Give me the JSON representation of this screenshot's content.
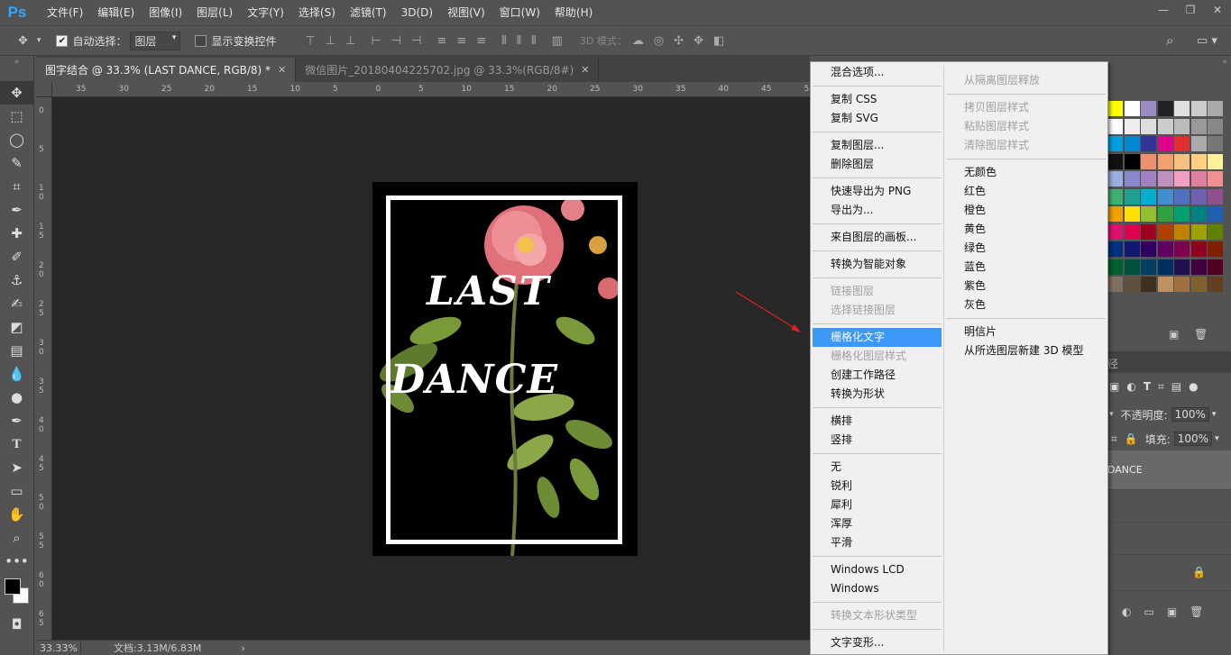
{
  "app": {
    "logo": "Ps"
  },
  "menu": [
    "文件(F)",
    "编辑(E)",
    "图像(I)",
    "图层(L)",
    "文字(Y)",
    "选择(S)",
    "滤镜(T)",
    "3D(D)",
    "视图(V)",
    "窗口(W)",
    "帮助(H)"
  ],
  "window_controls": {
    "minimize": "—",
    "restore": "❐",
    "close": "✕"
  },
  "options": {
    "auto_select_label": "自动选择：",
    "auto_select_value": "图层",
    "show_transform_label": "显示变换控件",
    "mode3d_label": "3D 模式："
  },
  "tabs": [
    {
      "title": "图字结合 @ 33.3% (LAST DANCE, RGB/8) *",
      "close": "✕"
    },
    {
      "title": "微信图片_20180404225702.jpg @ 33.3%(RGB/8#)",
      "close": "✕"
    }
  ],
  "ruler": {
    "top": [
      "35",
      "30",
      "25",
      "20",
      "15",
      "10",
      "5",
      "0",
      "5",
      "10",
      "15",
      "20",
      "25",
      "30",
      "35",
      "40",
      "45",
      "5"
    ],
    "left": [
      "0",
      "5",
      "1\n0",
      "1\n5",
      "2\n0",
      "2\n5",
      "3\n0",
      "3\n5",
      "4\n0",
      "4\n5",
      "5\n0",
      "5\n5",
      "6\n0",
      "6\n5"
    ]
  },
  "artwork": {
    "line1": "LAST",
    "line2": "DANCE"
  },
  "status": {
    "zoom": "33.33%",
    "doc": "文档:3.13M/6.83M",
    "arrow": "›"
  },
  "context_menu": {
    "col1": [
      {
        "t": "混合选项...",
        "s": "n"
      },
      {
        "sep": true
      },
      {
        "t": "复制 CSS",
        "s": "n"
      },
      {
        "t": "复制 SVG",
        "s": "n"
      },
      {
        "sep": true
      },
      {
        "t": "复制图层...",
        "s": "n"
      },
      {
        "t": "删除图层",
        "s": "n"
      },
      {
        "sep": true
      },
      {
        "t": "快速导出为 PNG",
        "s": "n"
      },
      {
        "t": "导出为...",
        "s": "n"
      },
      {
        "sep": true
      },
      {
        "t": "来自图层的画板...",
        "s": "n"
      },
      {
        "sep": true
      },
      {
        "t": "转换为智能对象",
        "s": "n"
      },
      {
        "sep": true
      },
      {
        "t": "链接图层",
        "s": "d"
      },
      {
        "t": "选择链接图层",
        "s": "d"
      },
      {
        "sep": true
      },
      {
        "t": "栅格化文字",
        "s": "h"
      },
      {
        "t": "栅格化图层样式",
        "s": "d"
      },
      {
        "t": "创建工作路径",
        "s": "n"
      },
      {
        "t": "转换为形状",
        "s": "n"
      },
      {
        "sep": true
      },
      {
        "t": "横排",
        "s": "n"
      },
      {
        "t": "竖排",
        "s": "n"
      },
      {
        "sep": true
      },
      {
        "t": "无",
        "s": "n"
      },
      {
        "t": "锐利",
        "s": "n"
      },
      {
        "t": "犀利",
        "s": "n"
      },
      {
        "t": "浑厚",
        "s": "n"
      },
      {
        "t": "平滑",
        "s": "n"
      },
      {
        "sep": true
      },
      {
        "t": "Windows LCD",
        "s": "n"
      },
      {
        "t": "Windows",
        "s": "n"
      },
      {
        "sep": true
      },
      {
        "t": "转换文本形状类型",
        "s": "d"
      },
      {
        "sep": true
      },
      {
        "t": "文字变形...",
        "s": "n"
      }
    ],
    "col2": [
      {
        "t": "从隔离图层释放",
        "s": "d"
      },
      {
        "sep": true
      },
      {
        "t": "拷贝图层样式",
        "s": "d"
      },
      {
        "t": "粘贴图层样式",
        "s": "d"
      },
      {
        "t": "清除图层样式",
        "s": "d"
      },
      {
        "sep": true
      },
      {
        "t": "无颜色",
        "s": "n"
      },
      {
        "t": "红色",
        "s": "n"
      },
      {
        "t": "橙色",
        "s": "n"
      },
      {
        "t": "黄色",
        "s": "n"
      },
      {
        "t": "绿色",
        "s": "n"
      },
      {
        "t": "蓝色",
        "s": "n"
      },
      {
        "t": "紫色",
        "s": "n"
      },
      {
        "t": "灰色",
        "s": "n"
      },
      {
        "sep": true
      },
      {
        "t": "明信片",
        "s": "n"
      },
      {
        "t": "从所选图层新建 3D 模型",
        "s": "n"
      }
    ]
  },
  "layers_panel": {
    "opacity_label": "不透明度:",
    "opacity_value": "100%",
    "fill_label": "填充:",
    "fill_value": "100%",
    "layer_name": "DANCE",
    "tab_fragment": "径"
  },
  "colors": {
    "accent": "#3c98f7",
    "arrow": "#e02020"
  }
}
